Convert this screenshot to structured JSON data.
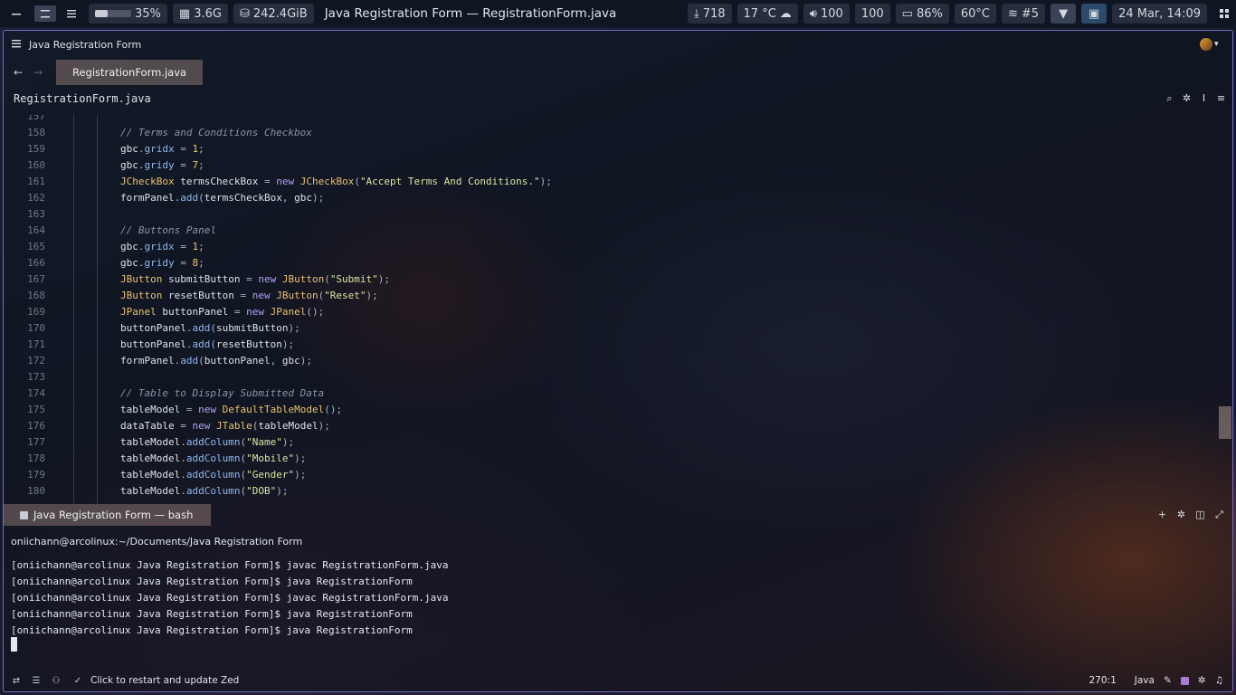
{
  "system_bar": {
    "cpu_percent": "35%",
    "cpu_usage_fraction": 0.35,
    "memory": "3.6G",
    "disk": "242.4GiB",
    "window_title": "Java Registration Form — RegistrationForm.java",
    "updates": "718",
    "weather": "17 °C",
    "volume": "100",
    "brightness": "100",
    "battery": "86%",
    "temperature": "60°C",
    "network": "#5",
    "datetime": "24 Mar, 14:09"
  },
  "titlebar": {
    "project": "Java Registration Form"
  },
  "tabs": [
    {
      "label": "RegistrationForm.java",
      "active": true
    }
  ],
  "breadcrumb": "RegistrationForm.java",
  "editor": {
    "lines": [
      {
        "n": "157",
        "code": ""
      },
      {
        "n": "158",
        "code": "// Terms and Conditions Checkbox"
      },
      {
        "n": "159",
        "code": "gbc.gridx = 1;"
      },
      {
        "n": "160",
        "code": "gbc.gridy = 7;"
      },
      {
        "n": "161",
        "code": "JCheckBox termsCheckBox = new JCheckBox(\"Accept Terms And Conditions.\");"
      },
      {
        "n": "162",
        "code": "formPanel.add(termsCheckBox, gbc);"
      },
      {
        "n": "163",
        "code": ""
      },
      {
        "n": "164",
        "code": "// Buttons Panel"
      },
      {
        "n": "165",
        "code": "gbc.gridx = 1;"
      },
      {
        "n": "166",
        "code": "gbc.gridy = 8;"
      },
      {
        "n": "167",
        "code": "JButton submitButton = new JButton(\"Submit\");"
      },
      {
        "n": "168",
        "code": "JButton resetButton = new JButton(\"Reset\");"
      },
      {
        "n": "169",
        "code": "JPanel buttonPanel = new JPanel();"
      },
      {
        "n": "170",
        "code": "buttonPanel.add(submitButton);"
      },
      {
        "n": "171",
        "code": "buttonPanel.add(resetButton);"
      },
      {
        "n": "172",
        "code": "formPanel.add(buttonPanel, gbc);"
      },
      {
        "n": "173",
        "code": ""
      },
      {
        "n": "174",
        "code": "// Table to Display Submitted Data"
      },
      {
        "n": "175",
        "code": "tableModel = new DefaultTableModel();"
      },
      {
        "n": "176",
        "code": "dataTable = new JTable(tableModel);"
      },
      {
        "n": "177",
        "code": "tableModel.addColumn(\"Name\");"
      },
      {
        "n": "178",
        "code": "tableModel.addColumn(\"Mobile\");"
      },
      {
        "n": "179",
        "code": "tableModel.addColumn(\"Gender\");"
      },
      {
        "n": "180",
        "code": "tableModel.addColumn(\"DOB\");"
      }
    ]
  },
  "terminal": {
    "tab_label": "Java Registration Form — bash",
    "path": "oniichann@arcolinux:~/Documents/Java Registration Form",
    "lines": [
      "[oniichann@arcolinux Java Registration Form]$ javac RegistrationForm.java",
      "[oniichann@arcolinux Java Registration Form]$ java RegistrationForm",
      "[oniichann@arcolinux Java Registration Form]$ javac RegistrationForm.java",
      "[oniichann@arcolinux Java Registration Form]$ java RegistrationForm",
      "[oniichann@arcolinux Java Registration Form]$ java RegistrationForm"
    ]
  },
  "statusbar": {
    "update_message": "Click to restart and update Zed",
    "cursor_position": "270:1",
    "language": "Java"
  },
  "icons": {
    "minimize": "minimize-icon",
    "menu": "hamburger-icon",
    "search": "search-icon",
    "split": "split-icon",
    "maximize": "maximize-icon"
  }
}
